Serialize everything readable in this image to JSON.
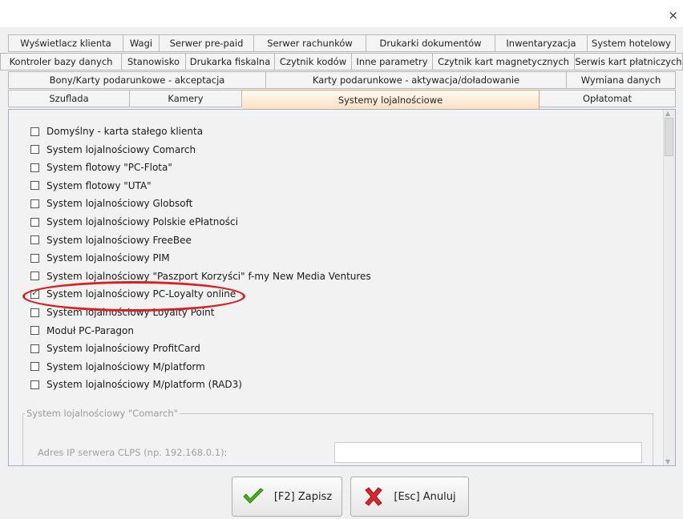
{
  "window": {
    "close_label": "×"
  },
  "tabs": {
    "row1": [
      "Wyświetlacz klienta",
      "Wagi",
      "Serwer pre-paid",
      "Serwer rachunków",
      "Drukarki dokumentów",
      "Inwentaryzacja",
      "System hotelowy"
    ],
    "row2": [
      "Kontroler bazy danych",
      "Stanowisko",
      "Drukarka fiskalna",
      "Czytnik kodów",
      "Inne parametry",
      "Czytnik kart magnetycznych",
      "Serwis kart płatniczych"
    ],
    "row3": [
      "Bony/Karty podarunkowe - akceptacja",
      "Karty podarunkowe - aktywacja/doładowanie",
      "Wymiana danych"
    ],
    "row4": [
      "Szuflada",
      "Kamery",
      "Systemy lojalnościowe",
      "Opłatomat"
    ],
    "active": "Systemy lojalnościowe"
  },
  "options": [
    {
      "label": "Domyślny - karta stałego klienta",
      "checked": false
    },
    {
      "label": "System lojalnościowy Comarch",
      "checked": false
    },
    {
      "label": "System flotowy \"PC-Flota\"",
      "checked": false
    },
    {
      "label": "System flotowy \"UTA\"",
      "checked": false
    },
    {
      "label": "System lojalnościowy Globsoft",
      "checked": false
    },
    {
      "label": "System lojalnościowy Polskie ePłatności",
      "checked": false
    },
    {
      "label": "System lojalnościowy FreeBee",
      "checked": false
    },
    {
      "label": "System lojalnościowy PIM",
      "checked": false
    },
    {
      "label": "System lojalnościowy \"Paszport Korzyści\" f-my New Media Ventures",
      "checked": false
    },
    {
      "label": "System lojalnościowy PC-Loyalty online",
      "checked": true
    },
    {
      "label": "System lojalnościowy Loyalty Point",
      "checked": false
    },
    {
      "label": "Moduł PC-Paragon",
      "checked": false
    },
    {
      "label": "System lojalnościowy ProfitCard",
      "checked": false
    },
    {
      "label": "System lojalnościowy M/platform",
      "checked": false
    },
    {
      "label": "System lojalnościowy M/platform (RAD3)",
      "checked": false
    }
  ],
  "comarch_group": {
    "legend": "System lojalnościowy \"Comarch\"",
    "ip_label": "Adres IP serwera CLPS (np. 192.168.0.1):",
    "ip_value": ""
  },
  "buttons": {
    "save_label": "[F2] Zapisz",
    "cancel_label": "[Esc] Anuluj"
  },
  "colors": {
    "highlight": "#d82020",
    "active_tab": "#fbe0c3",
    "save_icon": "#4caf1e",
    "cancel_icon": "#d8282e"
  }
}
